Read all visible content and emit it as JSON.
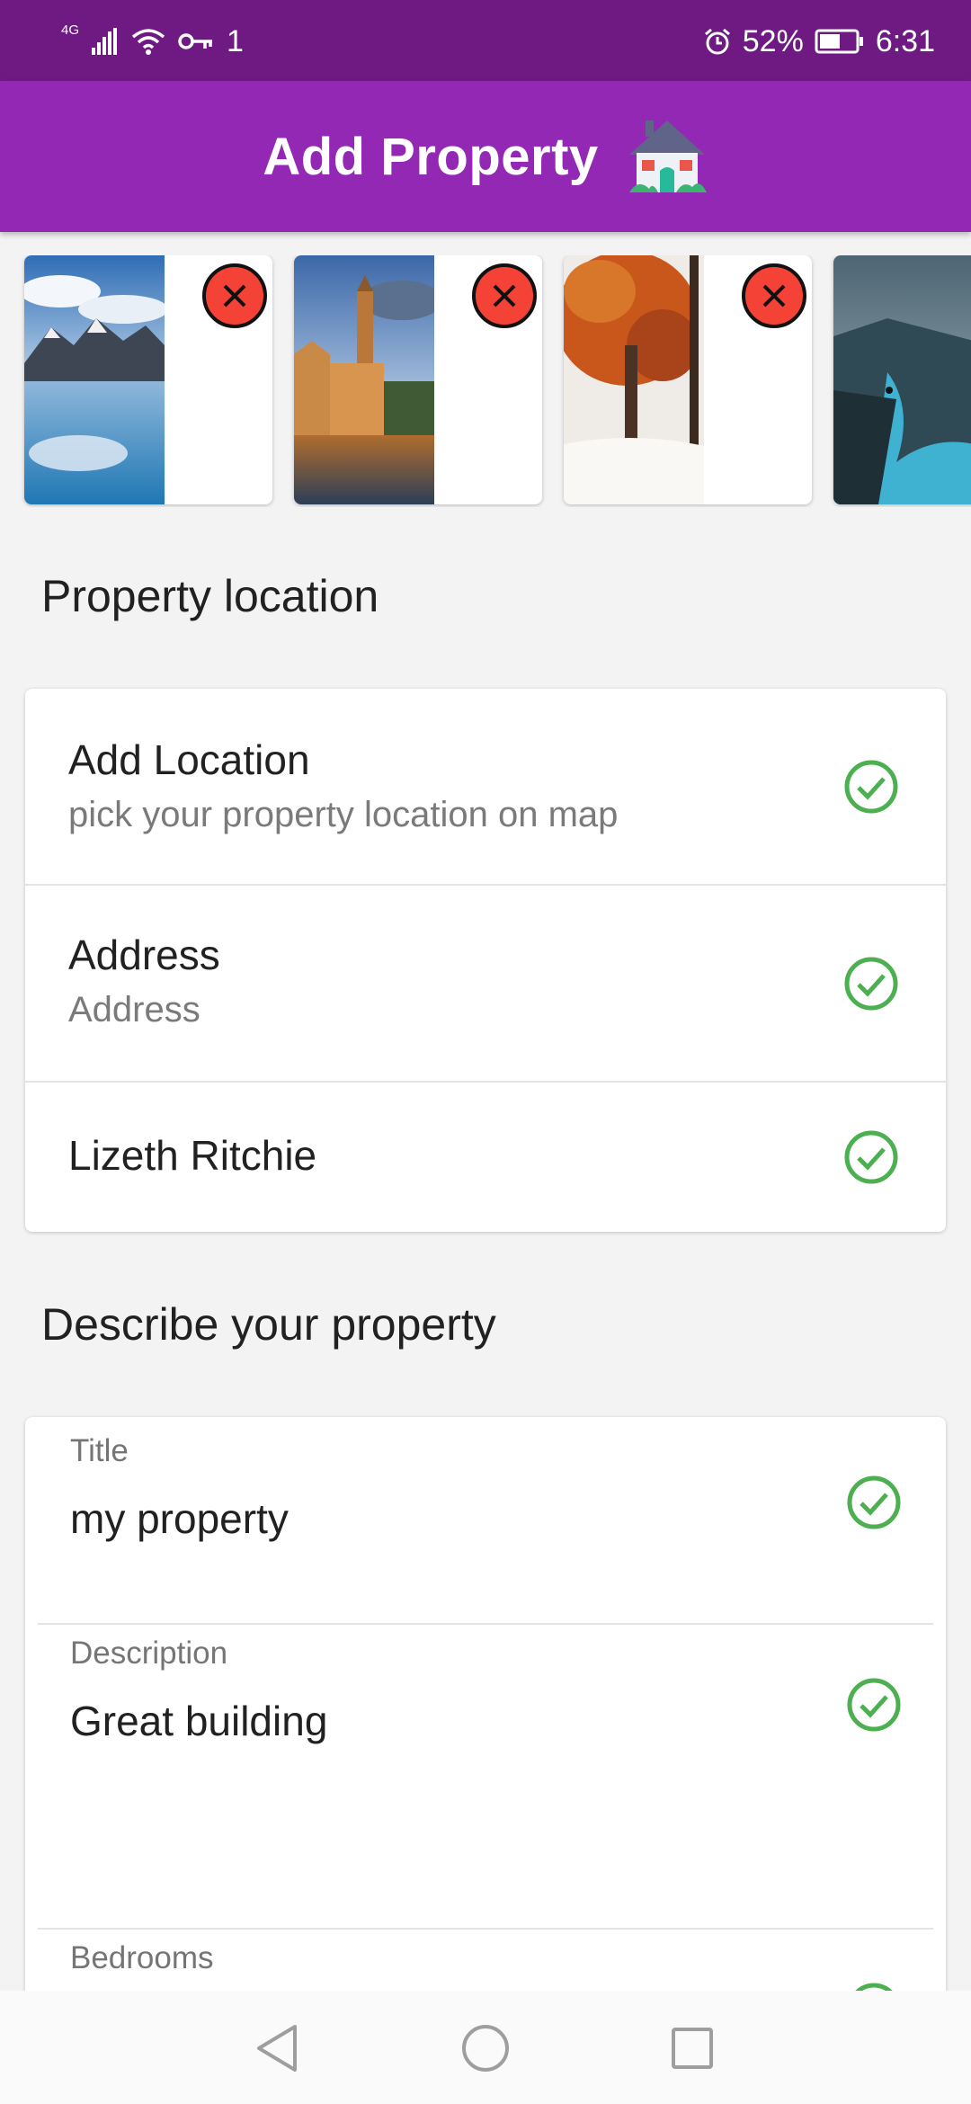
{
  "status_bar": {
    "network": "4G",
    "extra": "1",
    "battery": "52%",
    "time": "6:31"
  },
  "app_bar": {
    "title": "Add Property",
    "icon": "house-icon"
  },
  "photos": [
    {
      "name": "mountain-lake-photo",
      "removable": true
    },
    {
      "name": "canal-town-photo",
      "removable": true
    },
    {
      "name": "autumn-tree-photo",
      "removable": true
    },
    {
      "name": "fjord-cliff-photo",
      "removable": false
    }
  ],
  "location_section": {
    "heading": "Property location",
    "items": [
      {
        "title": "Add Location",
        "subtitle": "pick your property location on map",
        "status": "check-icon"
      },
      {
        "title": "Address",
        "subtitle": "Address",
        "status": "check-icon"
      },
      {
        "title": "Lizeth Ritchie",
        "status": "check-icon"
      }
    ]
  },
  "describe_section": {
    "heading": "Describe your property",
    "fields": [
      {
        "label": "Title",
        "value": "my property"
      },
      {
        "label": "Description",
        "value": "Great building"
      },
      {
        "label": "Bedrooms",
        "value": ""
      }
    ]
  },
  "colors": {
    "status_bar": "#6f1a82",
    "app_bar": "#9228b3",
    "check": "#4caf50",
    "remove": "#f44336"
  },
  "nav_bar": {
    "back": "back-triangle-icon",
    "home": "home-circle-icon",
    "recents": "recents-square-icon"
  }
}
